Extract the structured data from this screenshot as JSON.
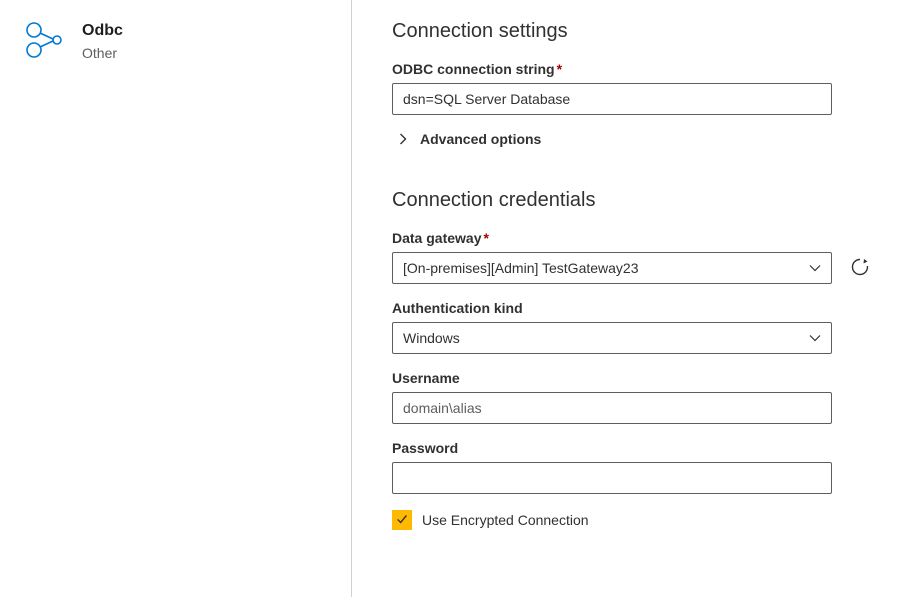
{
  "connector": {
    "title": "Odbc",
    "subtitle": "Other",
    "icon": "odbc-icon"
  },
  "settings": {
    "heading": "Connection settings",
    "connectionString": {
      "label": "ODBC connection string",
      "required": true,
      "value": "dsn=SQL Server Database"
    },
    "advancedOptions": {
      "label": "Advanced options"
    }
  },
  "credentials": {
    "heading": "Connection credentials",
    "gateway": {
      "label": "Data gateway",
      "required": true,
      "value": "[On-premises][Admin] TestGateway23"
    },
    "authKind": {
      "label": "Authentication kind",
      "value": "Windows"
    },
    "username": {
      "label": "Username",
      "placeholder": "domain\\alias",
      "value": ""
    },
    "password": {
      "label": "Password",
      "value": ""
    },
    "useEncrypted": {
      "label": "Use Encrypted Connection",
      "checked": true
    }
  }
}
